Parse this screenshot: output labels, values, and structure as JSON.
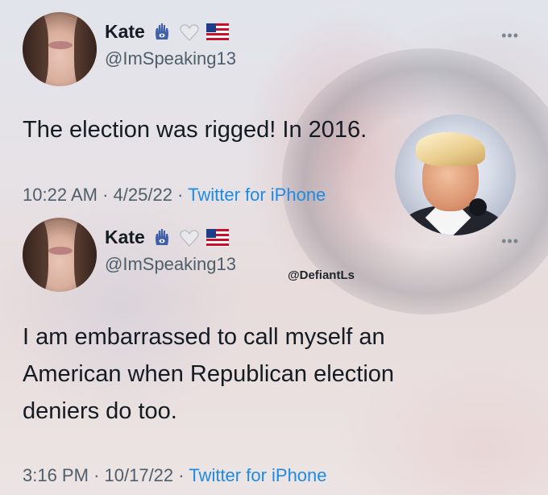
{
  "tweets": [
    {
      "name": "Kate",
      "handle": "@ImSpeaking13",
      "text_lines": [
        "The election was rigged! In 2016."
      ],
      "time": "10:22 AM",
      "date": "4/25/22",
      "separator": "·",
      "source": "Twitter for iPhone",
      "badges": [
        "hamsa-hand-icon",
        "white-heart-icon",
        "us-flag-icon"
      ]
    },
    {
      "name": "Kate",
      "handle": "@ImSpeaking13",
      "text_lines": [
        "I am embarrassed to call myself an",
        "American when Republican election",
        "deniers do too."
      ],
      "time": "3:16 PM",
      "date": "10/17/22",
      "separator": "·",
      "source": "Twitter for iPhone",
      "badges": [
        "hamsa-hand-icon",
        "white-heart-icon",
        "us-flag-icon"
      ]
    }
  ],
  "watermark": "@DefiantLs",
  "colors": {
    "text": "#151b22",
    "secondary": "#4f5e6a",
    "link": "#1d8be3"
  }
}
